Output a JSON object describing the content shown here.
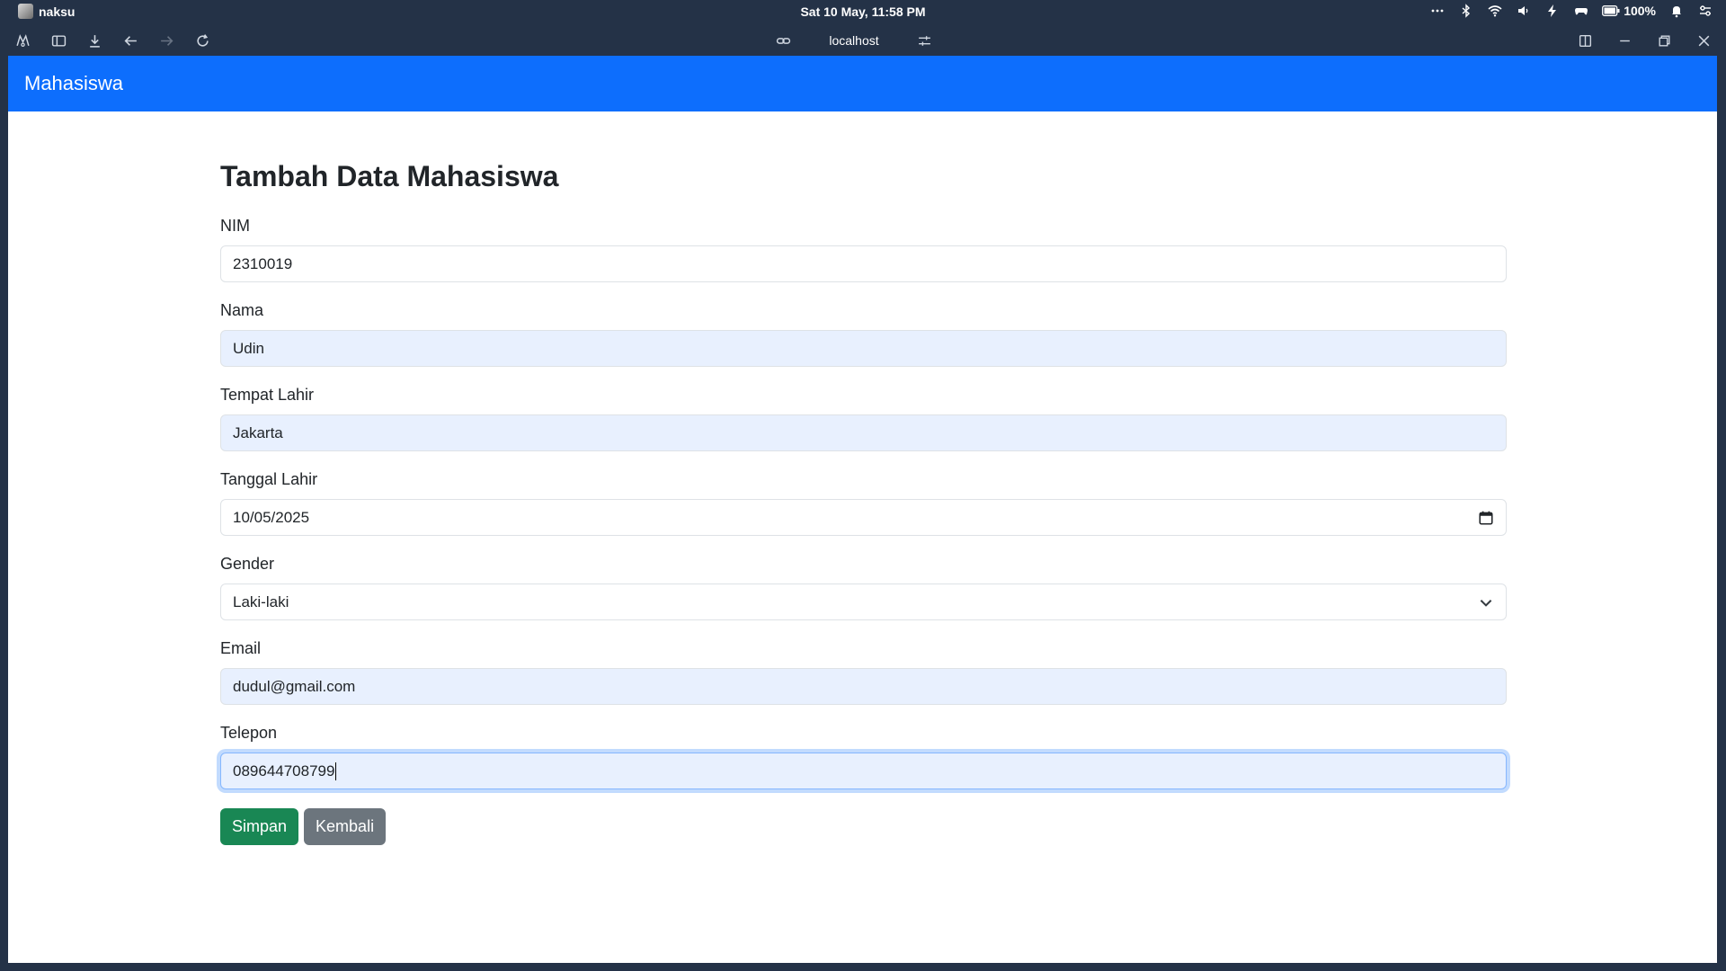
{
  "os": {
    "user": "naksu",
    "clock": "Sat 10 May, 11:58 PM",
    "battery": "100%",
    "icons": [
      "more-icon",
      "bluetooth-icon",
      "wifi-icon",
      "volume-icon",
      "charging-icon",
      "gamepad-icon",
      "battery-icon",
      "bell-icon",
      "settings-toggle-icon"
    ]
  },
  "browser": {
    "url": "localhost"
  },
  "navbar": {
    "brand": "Mahasiswa"
  },
  "form": {
    "title": "Tambah Data Mahasiswa",
    "nim": {
      "label": "NIM",
      "value": "2310019"
    },
    "nama": {
      "label": "Nama",
      "value": "Udin"
    },
    "tempat_lahir": {
      "label": "Tempat Lahir",
      "value": "Jakarta"
    },
    "tanggal_lahir": {
      "label": "Tanggal Lahir",
      "value": "10/05/2025"
    },
    "gender": {
      "label": "Gender",
      "value": "Laki-laki"
    },
    "email": {
      "label": "Email",
      "value": "dudul@gmail.com"
    },
    "telepon": {
      "label": "Telepon",
      "value": "089644708799"
    },
    "save_label": "Simpan",
    "back_label": "Kembali"
  },
  "colors": {
    "primary": "#0d6efd",
    "success": "#198754",
    "secondary": "#6c757d",
    "autofill": "#e8f0fe",
    "os_bar": "#243247"
  }
}
